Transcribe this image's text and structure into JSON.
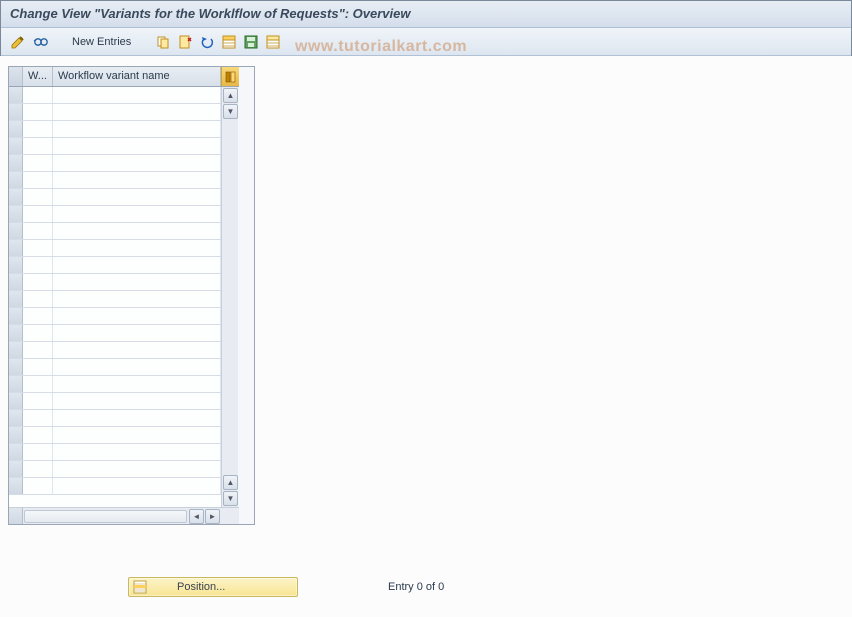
{
  "title": "Change View \"Variants for the Worklflow of Requests\": Overview",
  "toolbar": {
    "new_entries_label": "New Entries",
    "icons": {
      "toggle": "toggle-display-change-icon",
      "glasses": "display-icon",
      "copy": "copy-icon",
      "delete": "delete-icon",
      "undo": "undo-icon",
      "select_all": "select-all-icon",
      "save": "save-icon",
      "deselect": "deselect-all-icon"
    }
  },
  "watermark": "www.tutorialkart.com",
  "table": {
    "columns": {
      "col1": "W...",
      "col2": "Workflow variant name"
    },
    "row_count": 24
  },
  "footer": {
    "position_label": "Position...",
    "entry_text": "Entry 0 of 0"
  }
}
